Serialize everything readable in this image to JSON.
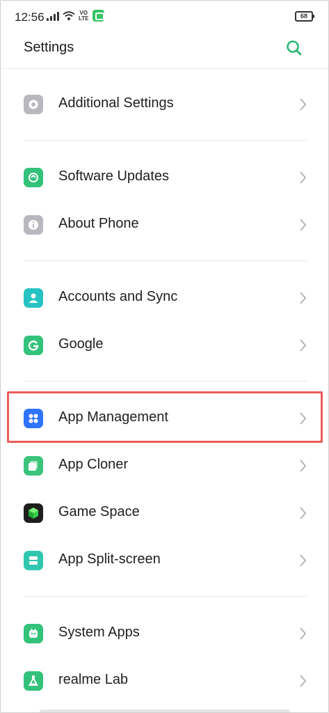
{
  "status_bar": {
    "time": "12:56",
    "volte": "Vo\nLTE",
    "battery": "68"
  },
  "header": {
    "title": "Settings",
    "search_icon": "search-icon",
    "accent_color": "#2bb673"
  },
  "menu": [
    {
      "label": "Additional Settings",
      "icon": "gear-icon",
      "icon_color": "#b8b8bf"
    },
    {
      "label": "Software Updates",
      "icon": "update-icon",
      "icon_color": "#34c27a"
    },
    {
      "label": "About Phone",
      "icon": "info-icon",
      "icon_color": "#b8b8bf"
    },
    {
      "label": "Accounts and Sync",
      "icon": "account-icon",
      "icon_color": "#27c2c2"
    },
    {
      "label": "Google",
      "icon": "google-icon",
      "icon_color": "#33c27a"
    },
    {
      "label": "App Management",
      "icon": "app-management-icon",
      "icon_color": "#2f74ff",
      "highlighted": true
    },
    {
      "label": "App Cloner",
      "icon": "app-cloner-icon",
      "icon_color": "#3cc47b"
    },
    {
      "label": "Game Space",
      "icon": "game-space-icon",
      "icon_color": "#1e1e1e"
    },
    {
      "label": "App Split-screen",
      "icon": "split-screen-icon",
      "icon_color": "#2fc7b0"
    },
    {
      "label": "System Apps",
      "icon": "system-apps-icon",
      "icon_color": "#33c27a"
    },
    {
      "label": "realme Lab",
      "icon": "lab-icon",
      "icon_color": "#33c27a"
    }
  ],
  "highlight_color": "#ec5b5b"
}
